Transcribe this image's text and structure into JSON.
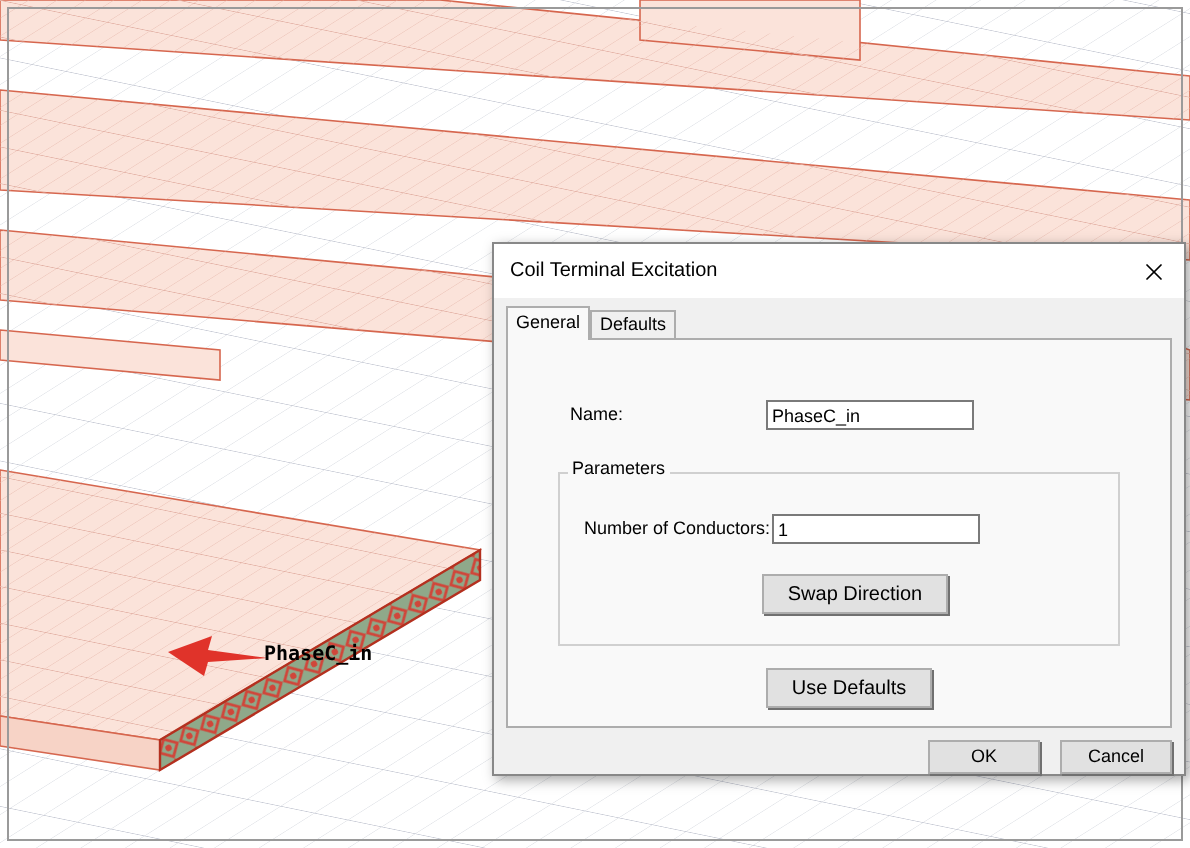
{
  "viewport": {
    "label": "PhaseC_in"
  },
  "dialog": {
    "title": "Coil Terminal Excitation",
    "tabs": [
      {
        "label": "General",
        "selected": true
      },
      {
        "label": "Defaults",
        "selected": false
      }
    ],
    "name_field": {
      "label": "Name:",
      "value": "PhaseC_in"
    },
    "parameters": {
      "title": "Parameters",
      "conductors_field": {
        "label": "Number of Conductors:",
        "value": "1"
      },
      "swap_button": "Swap Direction"
    },
    "use_defaults_button": "Use Defaults",
    "buttons": [
      "OK",
      "Cancel"
    ]
  }
}
